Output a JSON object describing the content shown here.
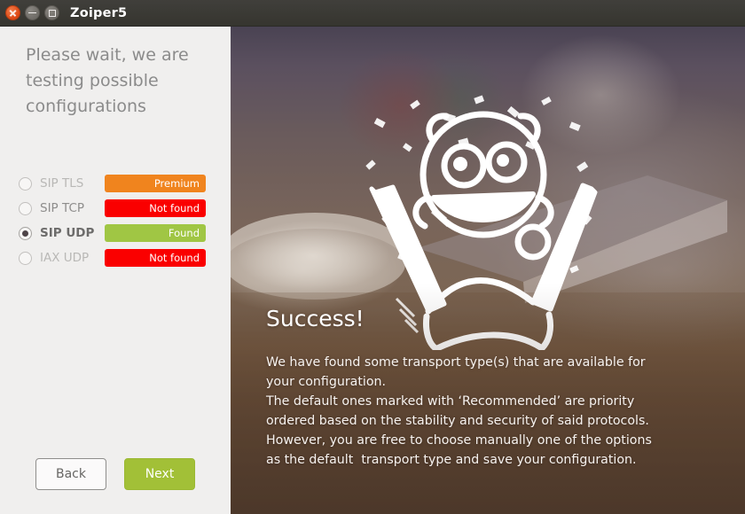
{
  "window": {
    "title": "Zoiper5",
    "controls": [
      {
        "name": "close",
        "glyph": "x"
      },
      {
        "name": "minimize",
        "glyph": "minus"
      },
      {
        "name": "maximize",
        "glyph": "square"
      }
    ]
  },
  "left": {
    "heading": "Please wait, we are testing possible configurations",
    "options": [
      {
        "label": "SIP TLS",
        "selected": false,
        "disabled": true,
        "badge": "Premium",
        "badge_color": "#f0841e"
      },
      {
        "label": "SIP TCP",
        "selected": false,
        "disabled": false,
        "badge": "Not found",
        "badge_color": "#fa0000"
      },
      {
        "label": "SIP UDP",
        "selected": true,
        "disabled": false,
        "badge": "Found",
        "badge_color": "#a0c644"
      },
      {
        "label": "IAX UDP",
        "selected": false,
        "disabled": true,
        "badge": "Not found",
        "badge_color": "#fa0000"
      }
    ],
    "back_label": "Back",
    "next_label": "Next"
  },
  "right": {
    "title": "Success!",
    "body": "We have found some transport type(s) that are available for\nyour configuration.\nThe default ones marked with ‘Recommended’ are priority\nordered based on the stability and security of said protocols.\nHowever, you are free to choose manually one of the options\nas the default  transport type and save your configuration.",
    "illustration": "celebrating-character-illustration"
  },
  "colors": {
    "titlebar": "#3c3b37",
    "panel_bg": "#f0efee",
    "accent_green": "#a2c037",
    "accent_orange": "#f0841e",
    "accent_red": "#fa0000"
  }
}
